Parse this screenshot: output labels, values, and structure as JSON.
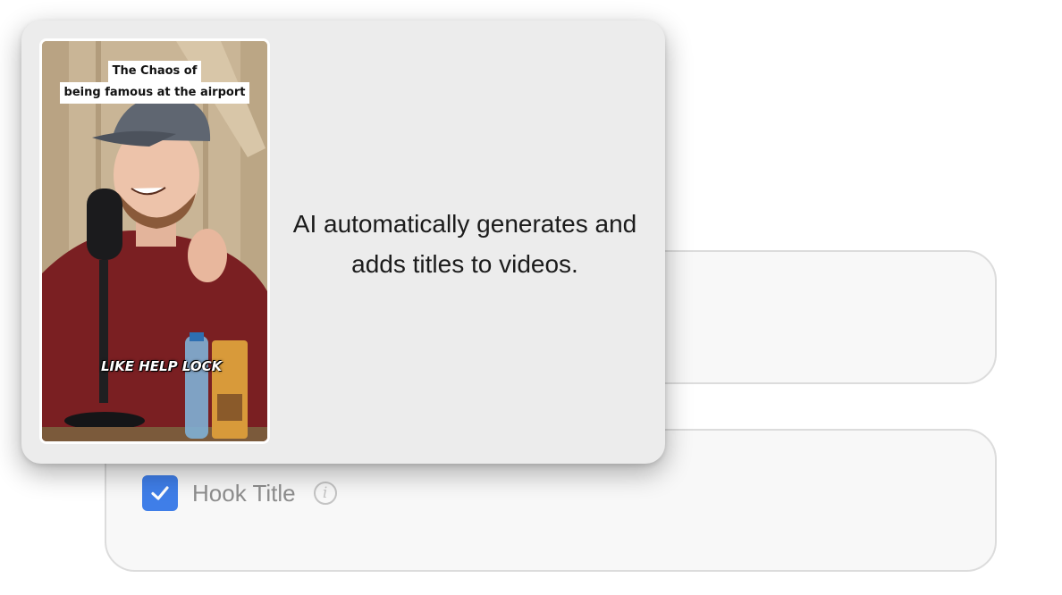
{
  "tooltip": {
    "video_title_line1": "The Chaos of",
    "video_title_line2": "being famous at the airport",
    "video_caption": "LIKE HELP LOCK",
    "description": "AI automatically generates and adds titles to videos."
  },
  "options": {
    "hook_title": {
      "label": "Hook Title",
      "checked": true,
      "info_icon": "info-icon"
    }
  },
  "colors": {
    "checkbox_accent": "#3f7ee8",
    "card_background": "#f8f8f8",
    "tooltip_background": "#ececec"
  }
}
